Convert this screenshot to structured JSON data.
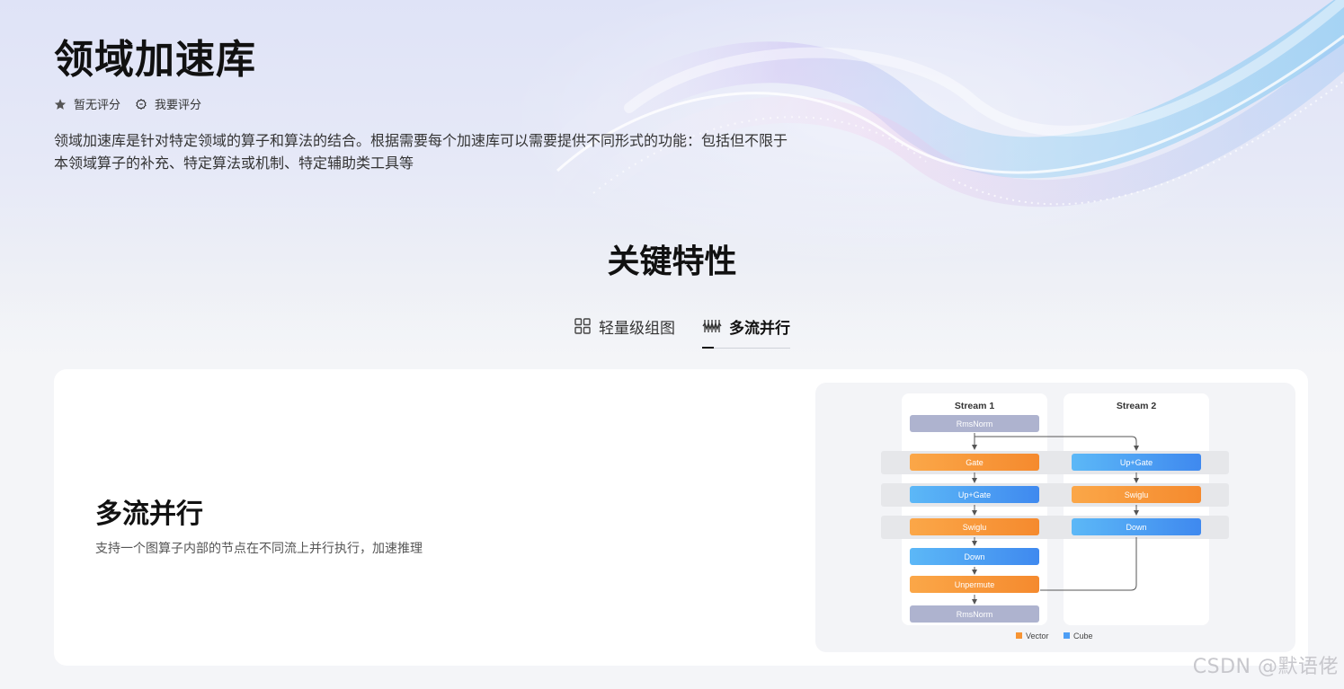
{
  "header": {
    "title": "领域加速库",
    "rating_text": "暂无评分",
    "rate_action": "我要评分",
    "description": "领域加速库是针对特定领域的算子和算法的结合。根据需要每个加速库可以需要提供不同形式的功能：包括但不限于本领域算子的补充、特定算法或机制、特定辅助类工具等"
  },
  "section": {
    "title": "关键特性",
    "tabs": [
      {
        "label": "轻量级组图",
        "icon": "grid-icon",
        "active": false
      },
      {
        "label": "多流并行",
        "icon": "waves-icon",
        "active": true
      }
    ]
  },
  "feature": {
    "title": "多流并行",
    "description": "支持一个图算子内部的节点在不同流上并行执行，加速推理"
  },
  "diagram": {
    "streams": [
      "Stream 1",
      "Stream 2"
    ],
    "stream1_nodes": [
      "RmsNorm",
      "Gate",
      "Up+Gate",
      "Swiglu",
      "Down",
      "Unpermute",
      "RmsNorm"
    ],
    "stream2_nodes": [
      "Up+Gate",
      "Swiglu",
      "Down"
    ],
    "legend": [
      {
        "label": "Vector",
        "color": "#f79433"
      },
      {
        "label": "Cube",
        "color": "#4d9ef5"
      }
    ],
    "colors": {
      "vector": "#f79433",
      "cube": "#4d9ef5",
      "norm": "#aeb3cf"
    }
  },
  "watermark": "CSDN @默语佬"
}
